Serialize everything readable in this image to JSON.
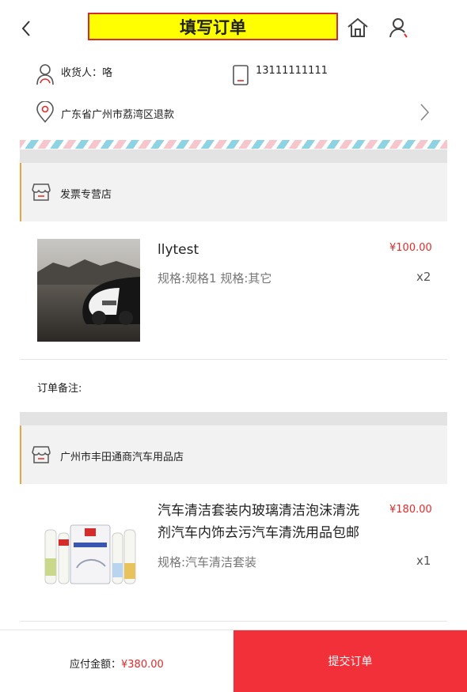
{
  "header": {
    "title": "填写订单"
  },
  "address": {
    "receiver": "收货人：咯",
    "phone": "13111111111",
    "location": "广东省广州市荔湾区退款"
  },
  "stores": [
    {
      "name": "发票专营店",
      "product": {
        "name": "llytest",
        "spec": "规格:规格1 规格:其它",
        "price": "¥100.00",
        "qty": "x2"
      },
      "note_label": "订单备注:"
    },
    {
      "name": "广州市丰田通商汽车用品店",
      "product": {
        "name": "汽车清洁套装内玻璃清洁泡沫清洗剂汽车内饰去污汽车清洗用品包邮",
        "spec": "规格:汽车清洁套装",
        "price": "¥180.00",
        "qty": "x1"
      }
    }
  ],
  "footer": {
    "total_label": "应付金额：",
    "total_amount": "¥380.00",
    "submit_label": "提交订单"
  },
  "colors": {
    "accent": "#f23039",
    "price": "#e32b2b",
    "title_bg": "#ffff00"
  }
}
